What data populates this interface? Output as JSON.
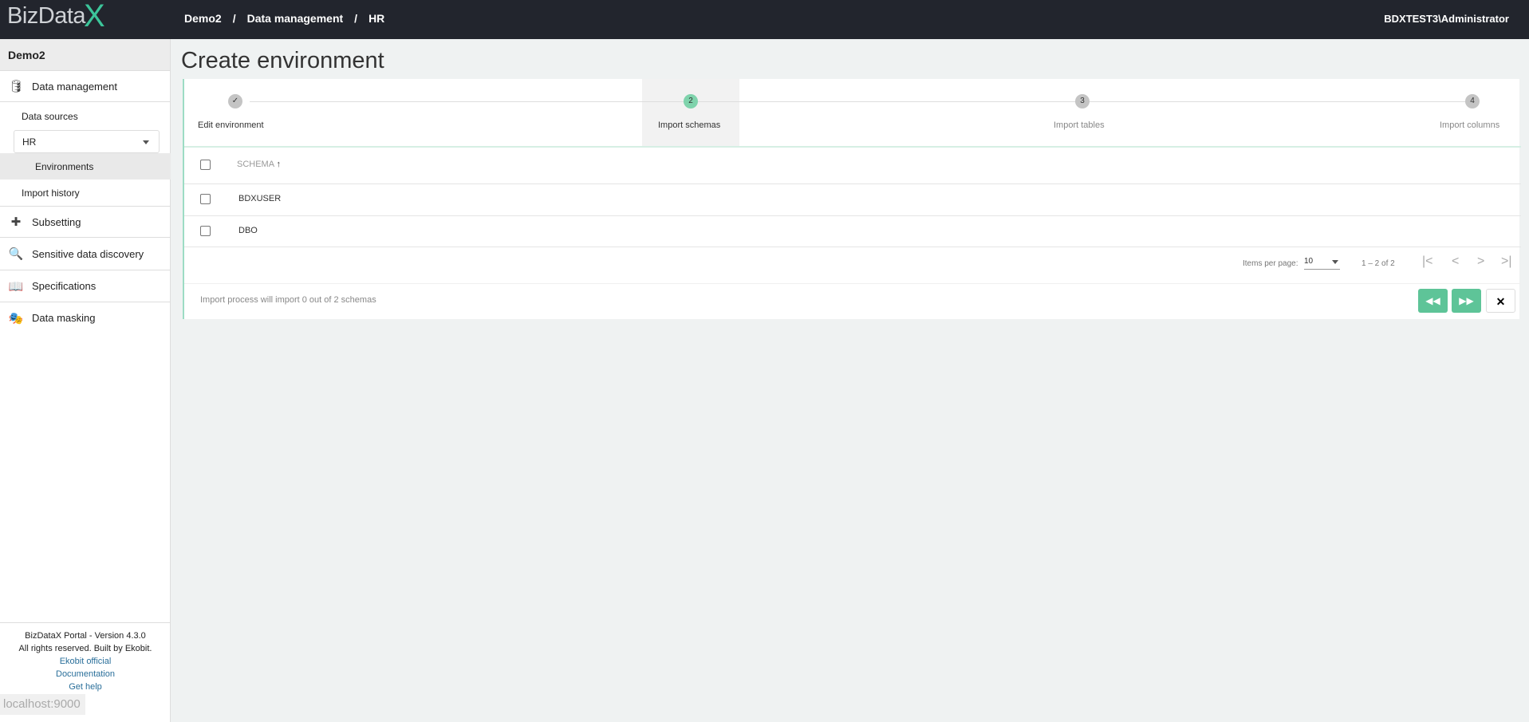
{
  "header": {
    "logo": "BizData",
    "logo_x": "X",
    "breadcrumb": [
      "Demo2",
      "/",
      "Data management",
      "/",
      "HR"
    ],
    "user": "BDXTEST3\\Administrator"
  },
  "sidebar": {
    "project": "Demo2",
    "data_management": {
      "label": "Data management",
      "icon": "database-icon"
    },
    "data_sources": "Data sources",
    "data_source_select": "HR",
    "environments": "Environments",
    "import_history": "Import history",
    "items": [
      {
        "label": "Subsetting",
        "icon": "puzzle-icon"
      },
      {
        "label": "Sensitive data discovery",
        "icon": "search-icon"
      },
      {
        "label": "Specifications",
        "icon": "book-icon"
      },
      {
        "label": "Data masking",
        "icon": "masks-icon"
      }
    ],
    "footer": {
      "version": "BizDataX Portal - Version 4.3.0",
      "rights": "All rights reserved. Built by Ekobit.",
      "links": [
        "Ekobit official",
        "Documentation",
        "Get help"
      ]
    },
    "status_url": "localhost:9000"
  },
  "page": {
    "title": "Create environment"
  },
  "stepper": {
    "steps": [
      {
        "num": "✓",
        "label": "Edit environment",
        "state": "done"
      },
      {
        "num": "2",
        "label": "Import schemas",
        "state": "active"
      },
      {
        "num": "3",
        "label": "Import tables",
        "state": "pending"
      },
      {
        "num": "4",
        "label": "Import columns",
        "state": "pending"
      }
    ]
  },
  "table": {
    "column": "SCHEMA",
    "sort": "↑",
    "rows": [
      "BDXUSER",
      "DBO"
    ]
  },
  "paginator": {
    "items_label": "Items per page:",
    "page_size": "10",
    "range": "1 – 2 of 2"
  },
  "footer": {
    "status": "Import process will import 0 out of 2 schemas",
    "back": "◀◀",
    "next": "▶▶",
    "close": "✕"
  },
  "colors": {
    "accent": "#5ec498",
    "header_bg": "#22252d"
  }
}
